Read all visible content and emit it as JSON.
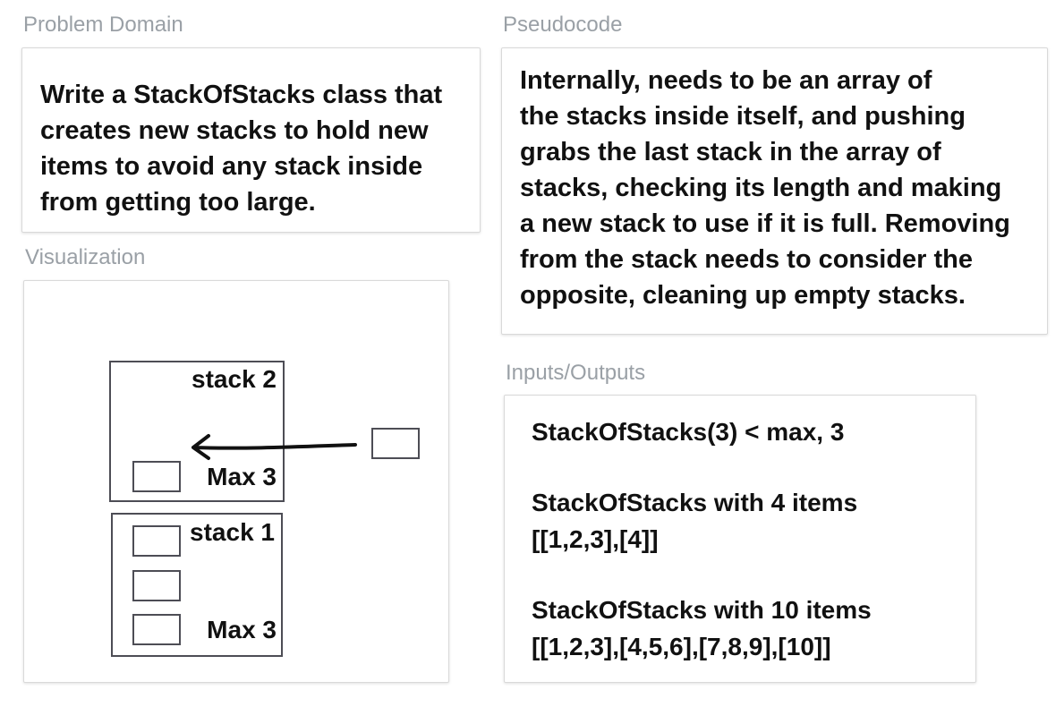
{
  "problem_domain": {
    "label": "Problem Domain",
    "text": "Write a StackOfStacks class that\ncreates new stacks to hold new\nitems to avoid any stack inside\nfrom getting too large."
  },
  "pseudocode": {
    "label": "Pseudocode",
    "text": "Internally, needs to be an array of\nthe stacks inside itself, and pushing\ngrabs the last stack in the array of\nstacks, checking its length and making\na new stack to use if it is full. Removing\nfrom the stack needs to consider the\nopposite, cleaning up empty stacks."
  },
  "visualization": {
    "label": "Visualization",
    "stack2": {
      "title": "stack 2",
      "max": "Max 3"
    },
    "stack1": {
      "title": "stack 1",
      "max": "Max 3"
    }
  },
  "io": {
    "label": "Inputs/Outputs",
    "lines": [
      "StackOfStacks(3) < max, 3",
      "StackOfStacks with 4 items",
      "[[1,2,3],[4]]",
      "StackOfStacks with 10 items",
      "[[1,2,3],[4,5,6],[7,8,9],[10]]"
    ]
  }
}
